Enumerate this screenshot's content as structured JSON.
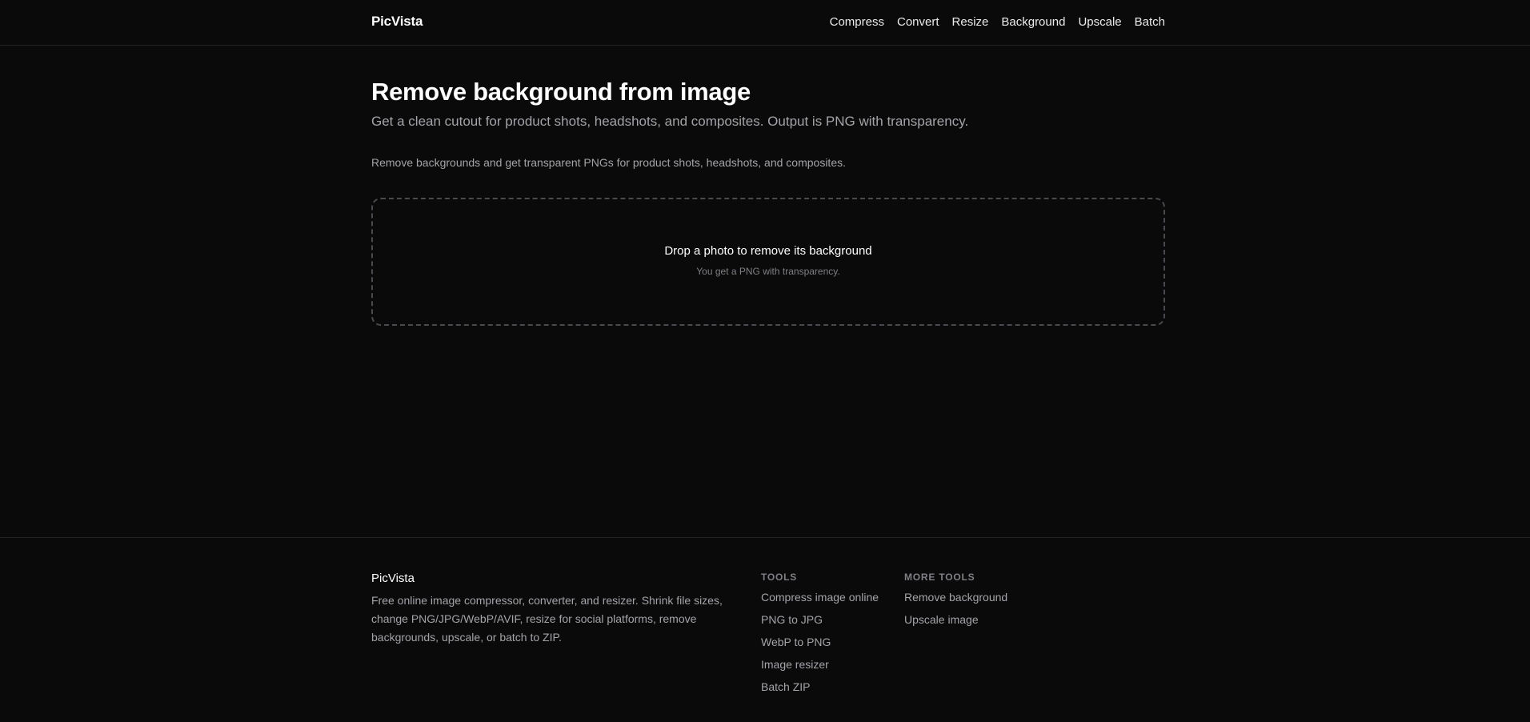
{
  "header": {
    "brand": "PicVista",
    "nav": [
      "Compress",
      "Convert",
      "Resize",
      "Background",
      "Upscale",
      "Batch"
    ]
  },
  "main": {
    "title": "Remove background from image",
    "subtitle": "Get a clean cutout for product shots, headshots, and composites. Output is PNG with transparency.",
    "intro": "Remove backgrounds and get transparent PNGs for product shots, headshots, and composites.",
    "dropzone": {
      "title": "Drop a photo to remove its background",
      "hint": "You get a PNG with transparency."
    }
  },
  "footer": {
    "brand": "PicVista",
    "description": "Free online image compressor, converter, and resizer. Shrink file sizes, change PNG/JPG/WebP/AVIF, resize for social platforms, remove backgrounds, upscale, or batch to ZIP.",
    "tools_heading": "TOOLS",
    "tools": [
      "Compress image online",
      "PNG to JPG",
      "WebP to PNG",
      "Image resizer",
      "Batch ZIP"
    ],
    "more_heading": "MORE TOOLS",
    "more_tools": [
      "Remove background",
      "Upscale image"
    ]
  }
}
